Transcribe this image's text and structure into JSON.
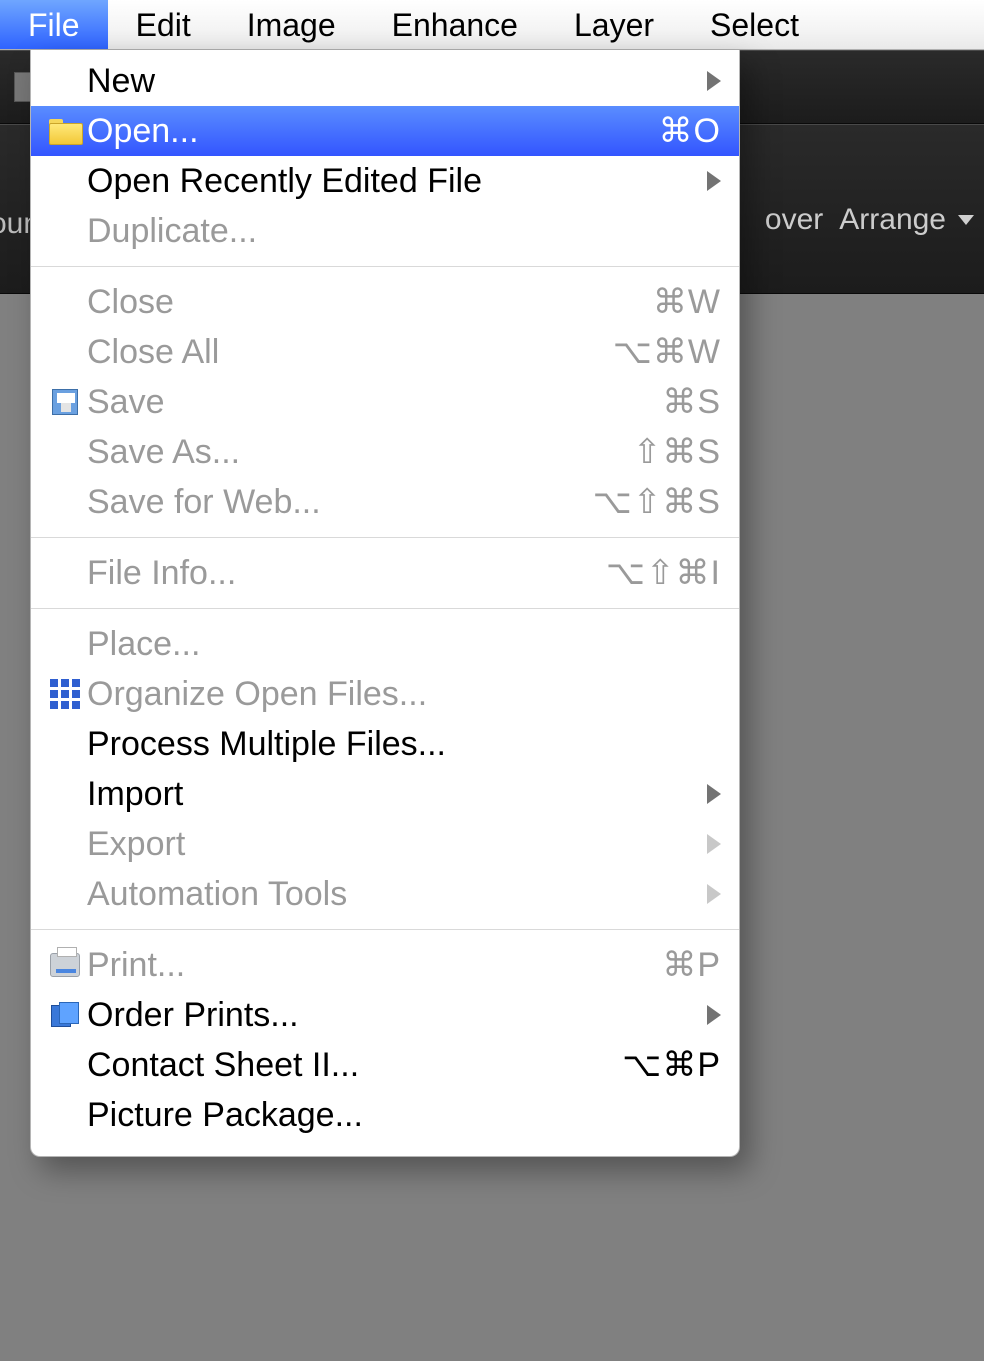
{
  "menubar": {
    "items": [
      {
        "label": "File",
        "active": true
      },
      {
        "label": "Edit"
      },
      {
        "label": "Image"
      },
      {
        "label": "Enhance"
      },
      {
        "label": "Layer"
      },
      {
        "label": "Select"
      }
    ]
  },
  "background_toolbar": {
    "row2_left_fragment": "ounding",
    "row2_right_fragment_a": "over",
    "arrange_label": "Arrange"
  },
  "dropdown": {
    "groups": [
      [
        {
          "id": "new",
          "label": "New",
          "submenu": true,
          "enabled": true
        },
        {
          "id": "open",
          "label": "Open...",
          "shortcut": "⌘O",
          "highlight": true,
          "icon": "folder",
          "enabled": true
        },
        {
          "id": "open-recent",
          "label": "Open Recently Edited File",
          "submenu": true,
          "enabled": true
        },
        {
          "id": "duplicate",
          "label": "Duplicate...",
          "enabled": false
        }
      ],
      [
        {
          "id": "close",
          "label": "Close",
          "shortcut": "⌘W",
          "enabled": false
        },
        {
          "id": "close-all",
          "label": "Close All",
          "shortcut": "⌥⌘W",
          "enabled": false
        },
        {
          "id": "save",
          "label": "Save",
          "shortcut": "⌘S",
          "icon": "save",
          "enabled": false
        },
        {
          "id": "save-as",
          "label": "Save As...",
          "shortcut": "⇧⌘S",
          "enabled": false
        },
        {
          "id": "save-for-web",
          "label": "Save for Web...",
          "shortcut": "⌥⇧⌘S",
          "enabled": false
        }
      ],
      [
        {
          "id": "file-info",
          "label": "File Info...",
          "shortcut": "⌥⇧⌘I",
          "enabled": false
        }
      ],
      [
        {
          "id": "place",
          "label": "Place...",
          "enabled": false
        },
        {
          "id": "organize",
          "label": "Organize Open Files...",
          "icon": "grid",
          "enabled": false
        },
        {
          "id": "process-multi",
          "label": "Process Multiple Files...",
          "enabled": true
        },
        {
          "id": "import",
          "label": "Import",
          "submenu": true,
          "enabled": true
        },
        {
          "id": "export",
          "label": "Export",
          "submenu": true,
          "enabled": false
        },
        {
          "id": "automation",
          "label": "Automation Tools",
          "submenu": true,
          "enabled": false
        }
      ],
      [
        {
          "id": "print",
          "label": "Print...",
          "shortcut": "⌘P",
          "icon": "printer",
          "enabled": false
        },
        {
          "id": "order-prints",
          "label": "Order Prints...",
          "submenu": true,
          "icon": "order",
          "enabled": true
        },
        {
          "id": "contact-sheet",
          "label": "Contact Sheet II...",
          "shortcut": "⌥⌘P",
          "enabled": true
        },
        {
          "id": "picture-pkg",
          "label": "Picture Package...",
          "enabled": true
        }
      ]
    ]
  }
}
